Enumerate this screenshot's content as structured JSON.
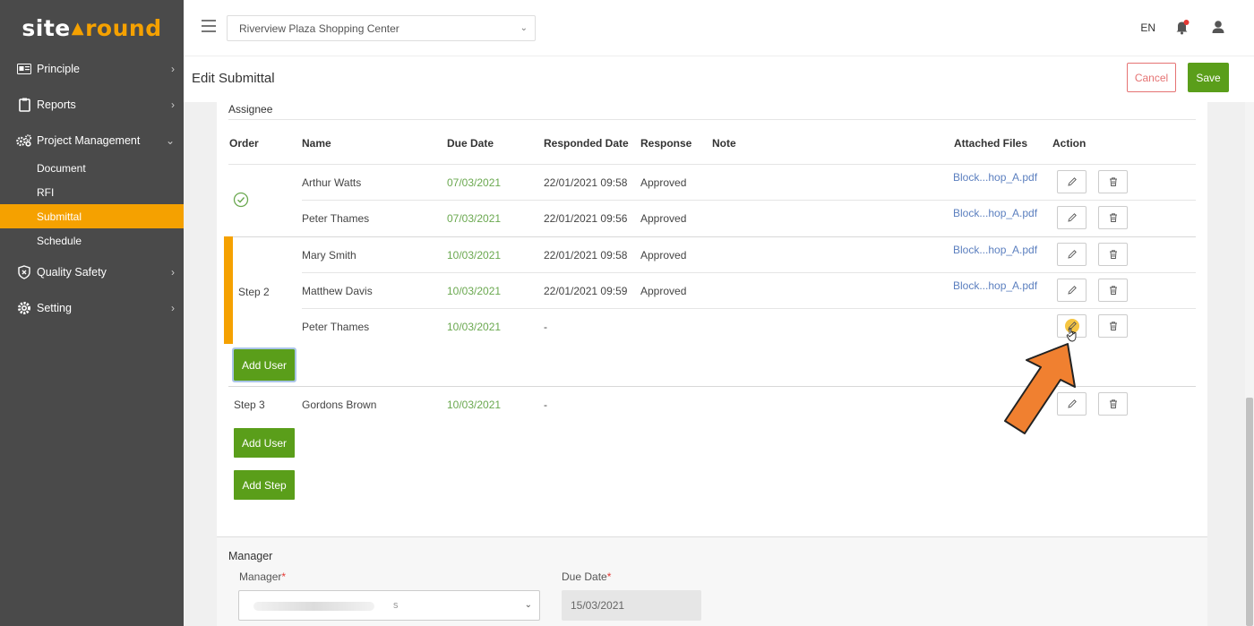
{
  "app": {
    "logo_part1": "site",
    "logo_part2": "round"
  },
  "sidebar": {
    "items": [
      {
        "label": "Principle",
        "icon": "id-card-icon"
      },
      {
        "label": "Reports",
        "icon": "clipboard-icon"
      },
      {
        "label": "Project Management",
        "icon": "cogs-icon"
      },
      {
        "label": "Quality Safety",
        "icon": "shield-icon"
      },
      {
        "label": "Setting",
        "icon": "gear-icon"
      }
    ],
    "sub_items": [
      {
        "label": "Document"
      },
      {
        "label": "RFI"
      },
      {
        "label": "Submittal",
        "active": true
      },
      {
        "label": "Schedule"
      }
    ]
  },
  "topbar": {
    "project": "Riverview Plaza Shopping Center",
    "language": "EN"
  },
  "header": {
    "title": "Edit Submittal",
    "cancel_label": "Cancel",
    "save_label": "Save"
  },
  "assignee": {
    "section_label": "Assignee",
    "columns": [
      "Order",
      "Name",
      "Due Date",
      "Responded Date",
      "Response",
      "Note",
      "Attached Files",
      "Action"
    ],
    "step1": {
      "rows": [
        {
          "name": "Arthur Watts",
          "due": "07/03/2021",
          "responded": "22/01/2021 09:58",
          "response": "Approved",
          "file": "Block...hop_A.pdf"
        },
        {
          "name": "Peter Thames",
          "due": "07/03/2021",
          "responded": "22/01/2021 09:56",
          "response": "Approved",
          "file": "Block...hop_A.pdf"
        }
      ]
    },
    "step2": {
      "label": "Step 2",
      "rows": [
        {
          "name": "Mary Smith",
          "due": "10/03/2021",
          "responded": "22/01/2021 09:58",
          "response": "Approved",
          "file": "Block...hop_A.pdf"
        },
        {
          "name": "Matthew Davis",
          "due": "10/03/2021",
          "responded": "22/01/2021 09:59",
          "response": "Approved",
          "file": "Block...hop_A.pdf"
        },
        {
          "name": "Peter Thames",
          "due": "10/03/2021",
          "responded": "-",
          "response": "",
          "file": ""
        }
      ],
      "add_user_label": "Add User"
    },
    "step3": {
      "label": "Step 3",
      "rows": [
        {
          "name": "Gordons Brown",
          "due": "10/03/2021",
          "responded": "-",
          "response": "",
          "file": ""
        }
      ],
      "add_user_label": "Add User",
      "add_step_label": "Add Step"
    }
  },
  "manager": {
    "section_label": "Manager",
    "manager_label": "Manager",
    "manager_value_tail": "s",
    "due_label": "Due Date",
    "due_value": "15/03/2021",
    "required_mark": "*"
  },
  "colors": {
    "accent": "#f5a100",
    "primary_green": "#5a9e1a",
    "sidebar_bg": "#4a4a4a",
    "cancel_red": "#e57373",
    "pointer_arrow": "#f08030"
  }
}
